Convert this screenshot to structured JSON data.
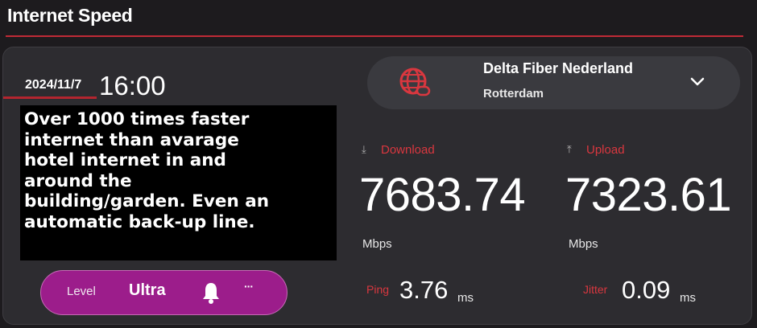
{
  "header": {
    "title": "Internet Speed"
  },
  "datetime": {
    "date": "2024/11/7",
    "time": "16:00"
  },
  "overlay": {
    "text": "Over 1000 times faster\ninternet than avarage\nhotel internet in and\naround the\nbuilding/garden. Even an\nautomatic back-up line."
  },
  "isp": {
    "name": "Delta Fiber Nederland",
    "city": "Rotterdam",
    "icon": "globe-icon"
  },
  "download": {
    "label": "Download",
    "value": "7683.74",
    "unit": "Mbps",
    "icon": "download-arrow-icon"
  },
  "upload": {
    "label": "Upload",
    "value": "7323.61",
    "unit": "Mbps",
    "icon": "upload-arrow-icon"
  },
  "ping": {
    "label": "Ping",
    "value": "3.76",
    "unit": "ms"
  },
  "jitter": {
    "label": "Jitter",
    "value": "0.09",
    "unit": "ms"
  },
  "level": {
    "label": "Level",
    "value": "Ultra",
    "more": "···"
  },
  "colors": {
    "accent": "#d9373f",
    "level_pill": "#9c1d8b",
    "panel": "#2d2c30",
    "background": "#1d1b1e"
  }
}
